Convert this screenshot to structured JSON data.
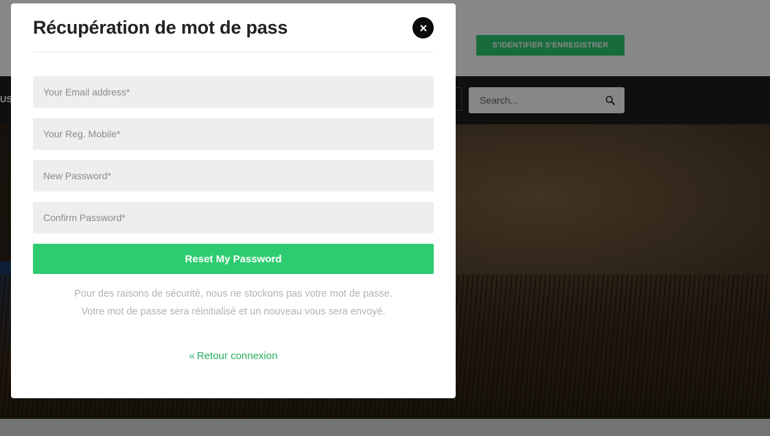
{
  "background": {
    "auth_button_label": "S'IDENTIFIER S'ENREGISTRER",
    "nav_fragment": "US",
    "search": {
      "placeholder": "Search...",
      "icon": "search-icon"
    }
  },
  "modal": {
    "title": "Récupération de mot de pass",
    "close_icon": "close-icon",
    "fields": {
      "email_placeholder": "Your Email address*",
      "mobile_placeholder": "Your Reg. Mobile*",
      "new_password_placeholder": "New Password*",
      "confirm_password_placeholder": "Confirm Password*"
    },
    "reset_button_label": "Reset My Password",
    "security_note": "Pour des raisons de sécurité, nous ne stockons pas votre mot de passe. Votre mot de passe sera réinitialisé et un nouveau vous sera envoyé.",
    "back_link": {
      "icon": "«",
      "label": "Retour connexion"
    }
  },
  "colors": {
    "accent": "#2ecc71",
    "link": "#27ae60",
    "nav_bar": "#1e1e1e",
    "overlay": "rgba(0,0,0,0.47)"
  }
}
